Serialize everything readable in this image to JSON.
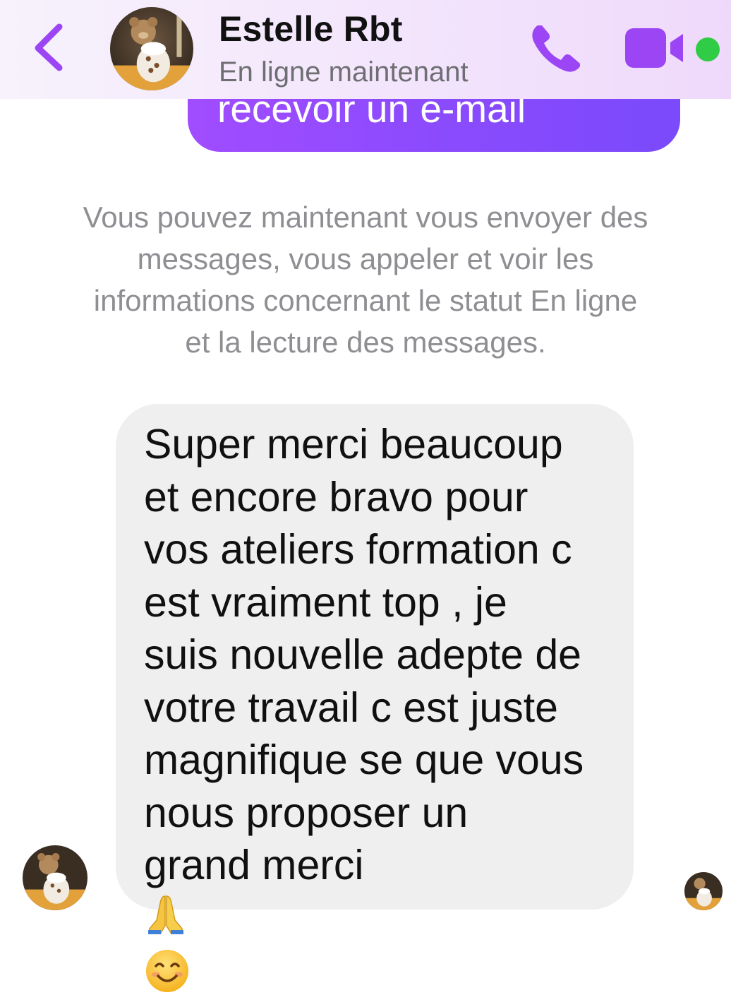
{
  "header": {
    "contact_name": "Estelle Rbt",
    "status": "En ligne maintenant",
    "accent_color": "#9b45f5",
    "online_color": "#31cc46",
    "icons": [
      "back-chevron-icon",
      "avatar",
      "phone-icon",
      "video-camera-icon",
      "online-indicator"
    ]
  },
  "conversation": {
    "sent_message_partial": "recevoir un e-mail",
    "notice_lines": [
      "Vous pouvez maintenant vous envoyer des",
      "messages, vous appeler et voir les",
      "informations concernant le statut En ligne",
      "et la lecture des messages."
    ],
    "received_message": {
      "lines": [
        "Super merci beaucoup",
        "et encore bravo pour",
        "vos ateliers formation c",
        "est vraiment top , je",
        "suis nouvelle adepte de",
        "votre travail c est juste",
        "magnifique se que vous",
        "nous proposer un"
      ],
      "last_line_text": "grand merci ",
      "emojis": [
        "folded-hands-emoji",
        "smiling-face-emoji"
      ]
    }
  }
}
